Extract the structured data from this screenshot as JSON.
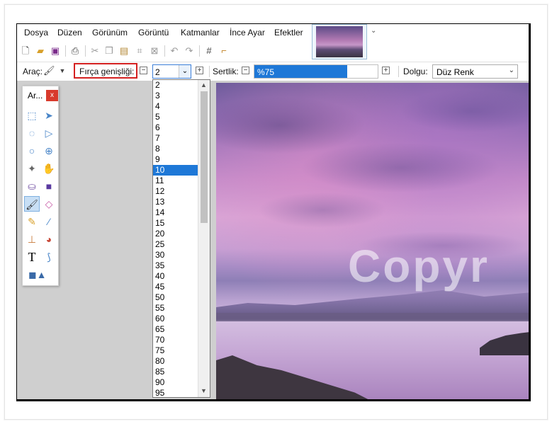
{
  "menubar": {
    "items": [
      "Dosya",
      "Düzen",
      "Görünüm",
      "Görüntü",
      "Katmanlar",
      "İnce Ayar",
      "Efektler"
    ]
  },
  "toolbar2": {
    "tool_label": "Araç:",
    "brush_width_label": "Fırça genişliği:",
    "brush_width_value": "2",
    "hardness_label": "Sertlik:",
    "hardness_value": "%75",
    "hardness_fraction": 0.75,
    "fill_label": "Dolgu:",
    "fill_value": "Düz Renk"
  },
  "tools_panel": {
    "title": "Ar...",
    "close": "x"
  },
  "dropdown": {
    "options": [
      "2",
      "3",
      "4",
      "5",
      "6",
      "7",
      "8",
      "9",
      "10",
      "11",
      "12",
      "13",
      "14",
      "15",
      "20",
      "25",
      "30",
      "35",
      "40",
      "45",
      "50",
      "55",
      "60",
      "65",
      "70",
      "75",
      "80",
      "85",
      "90",
      "95"
    ],
    "selected": "10"
  },
  "canvas": {
    "watermark": "Copyr"
  },
  "colors": {
    "accent": "#1e78d7",
    "highlight_box": "#d42020",
    "close_button": "#d83a2c"
  }
}
